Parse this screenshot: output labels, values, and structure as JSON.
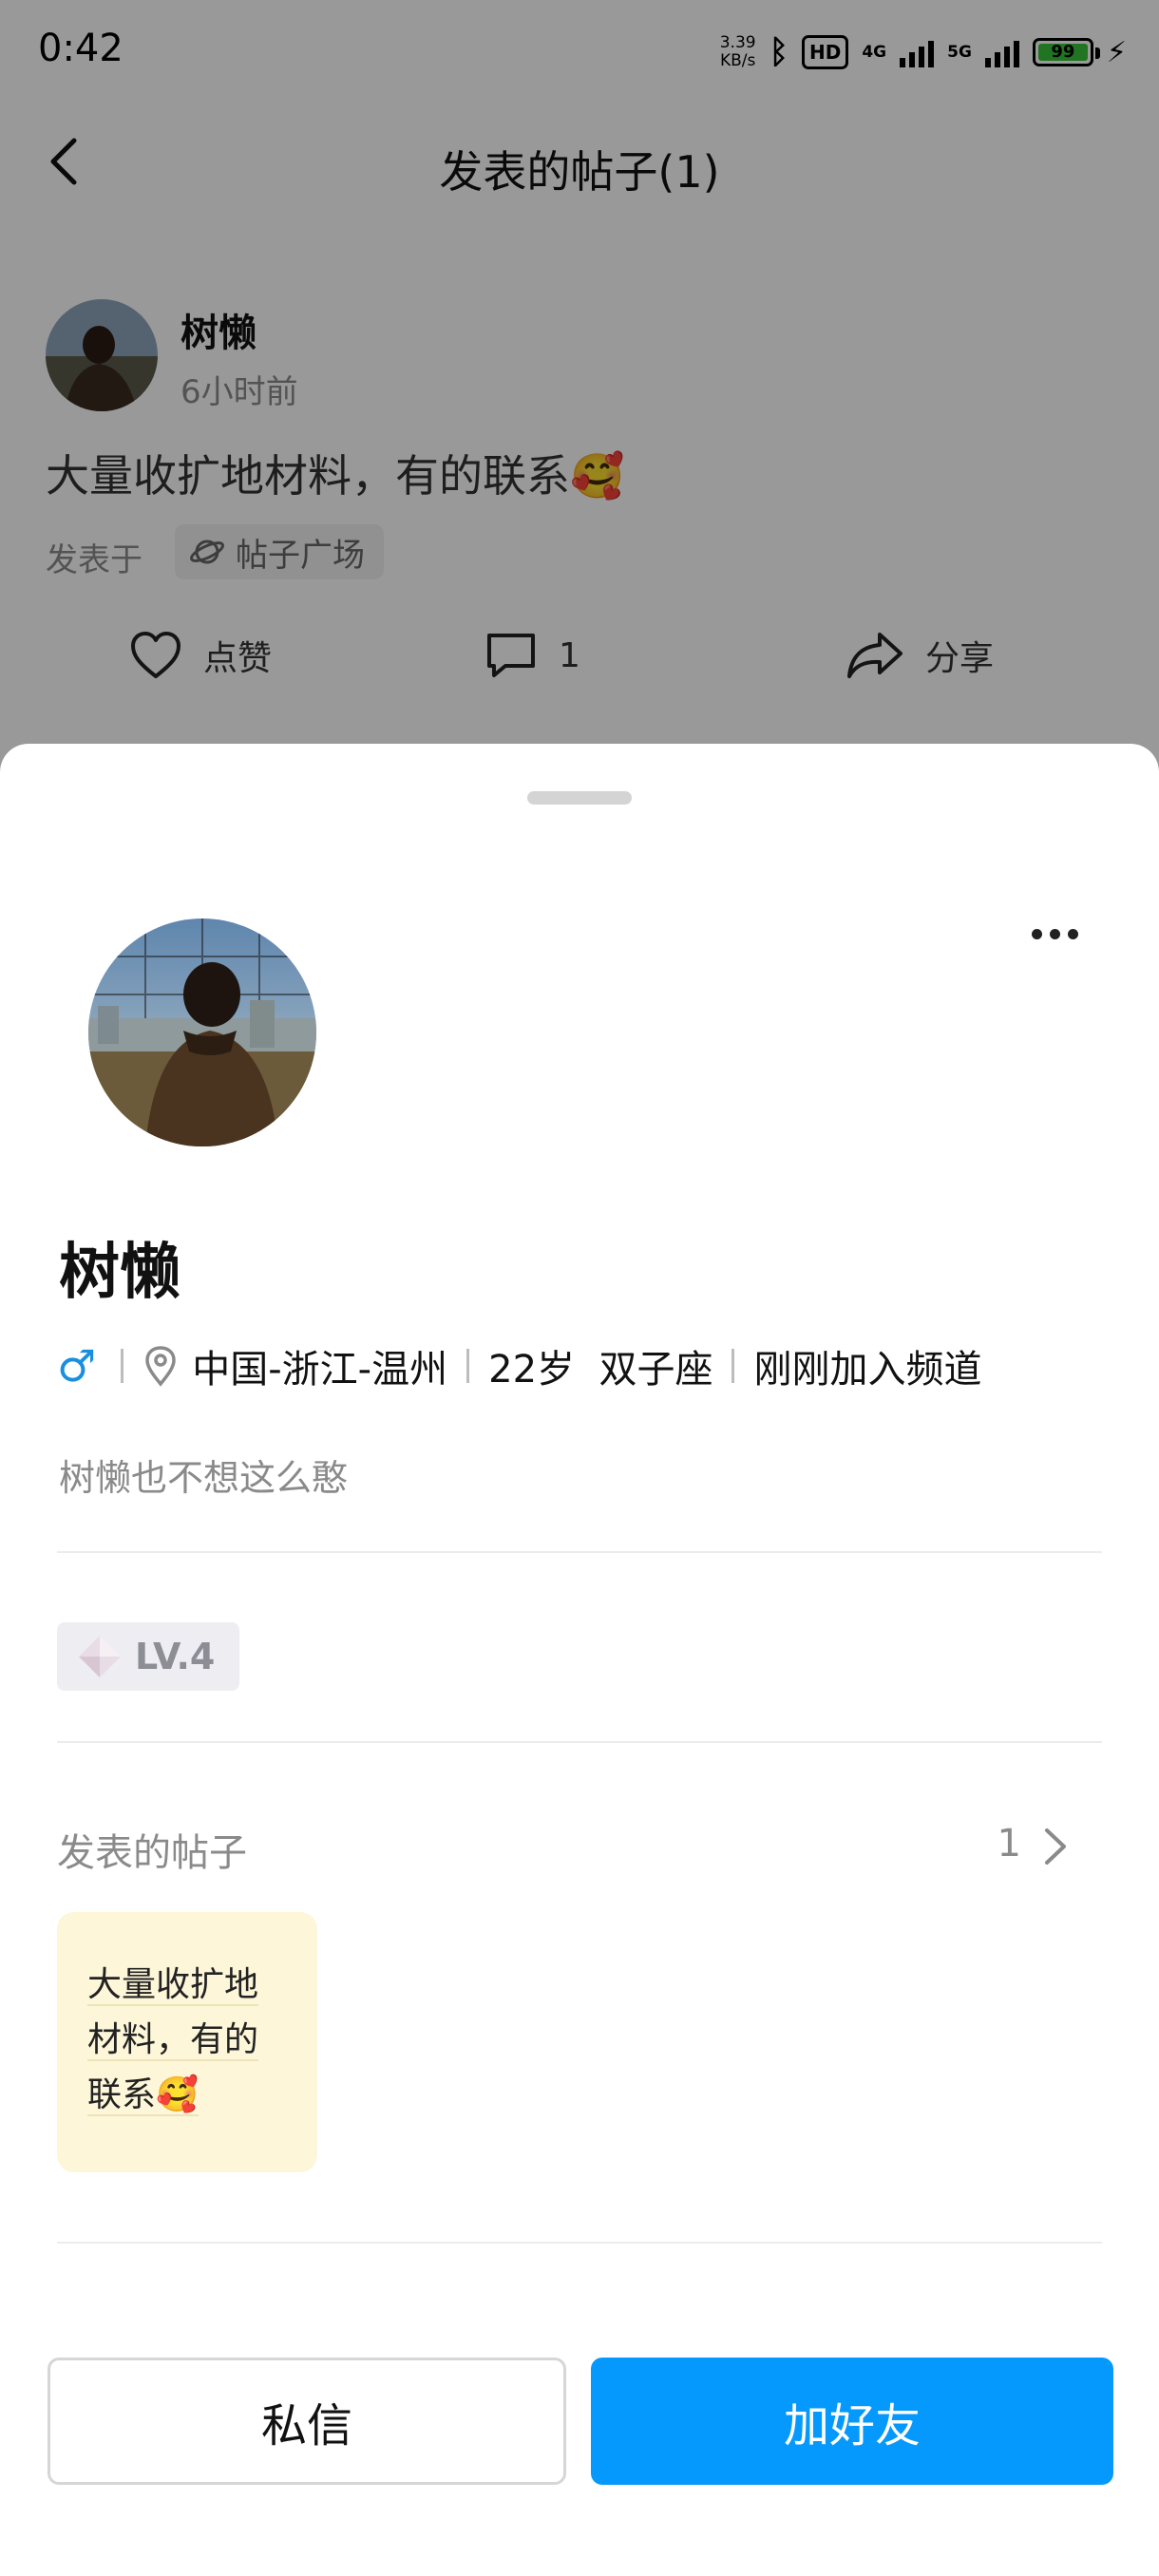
{
  "status_bar": {
    "time": "0:42",
    "net_speed_value": "3.39",
    "net_speed_unit": "KB/s",
    "hd_label": "HD",
    "network_4g": "4G",
    "network_5g": "5G",
    "battery_level": "99"
  },
  "header": {
    "title": "发表的帖子(1)"
  },
  "post": {
    "author": "树懒",
    "time_ago": "6小时前",
    "content": "大量收扩地材料，有的联系🥰",
    "posted_in_label": "发表于",
    "channel": "帖子广场",
    "like_label": "点赞",
    "comment_count": "1",
    "share_label": "分享"
  },
  "profile": {
    "name": "树懒",
    "gender_symbol": "♂",
    "location": "中国-浙江-温州",
    "age_sign": "22岁  双子座",
    "join_status": "刚刚加入频道",
    "bio": "树懒也不想这么憨",
    "level": "LV.4"
  },
  "posts_section": {
    "title": "发表的帖子",
    "count": "1",
    "thumbnail_lines": [
      "大量收扩地",
      "材料，有的",
      "联系🥰"
    ]
  },
  "buttons": {
    "message": "私信",
    "add_friend": "加好友"
  },
  "icons": {
    "back": "chevron-left-icon",
    "like": "heart-icon",
    "comment": "comment-icon",
    "share": "share-icon",
    "more": "more-dots-icon",
    "location": "location-pin-icon",
    "level": "diamond-icon",
    "channel": "planet-icon"
  },
  "colors": {
    "accent": "#0699fd",
    "gender": "#1a8fe0",
    "thumbnail_bg": "#fdf6d8",
    "battery": "#37c33a"
  }
}
